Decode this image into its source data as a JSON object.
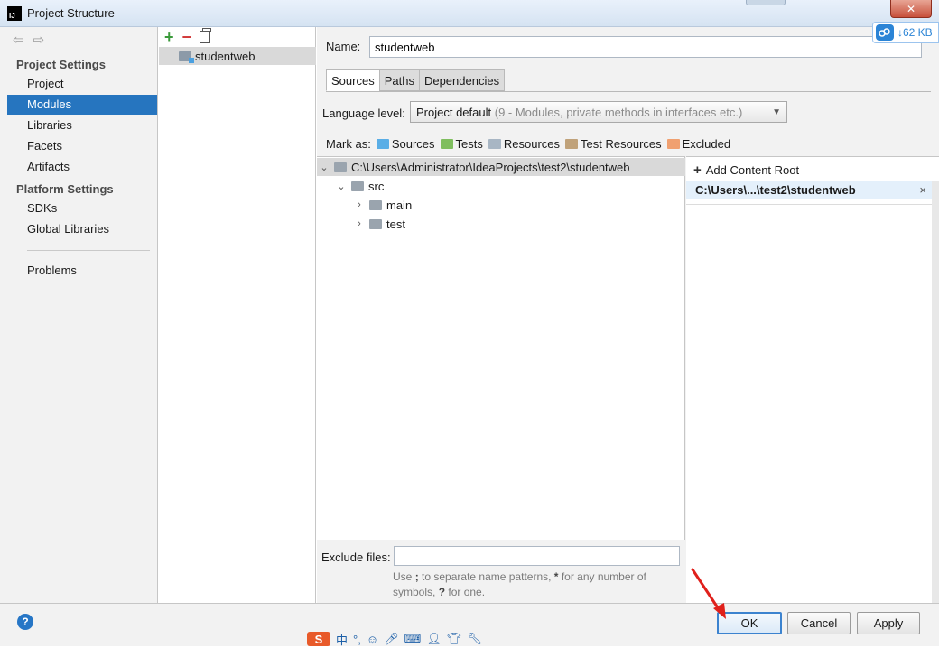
{
  "window": {
    "title": "Project Structure",
    "app_icon": "IJ",
    "close_glyph": "✕",
    "cloud_widget": {
      "icon": "baidu-cloud-icon",
      "text": "↓62 KB"
    }
  },
  "nav": {
    "back_forward_glyphs": "⇦⇨",
    "project_settings_header": "Project Settings",
    "project_settings_items": [
      "Project",
      "Modules",
      "Libraries",
      "Facets",
      "Artifacts"
    ],
    "selected_item": "Modules",
    "platform_settings_header": "Platform Settings",
    "platform_settings_items": [
      "SDKs",
      "Global Libraries"
    ],
    "problems_item": "Problems"
  },
  "modules": {
    "toolbar": {
      "add": "+",
      "remove": "−"
    },
    "items": [
      {
        "name": "studentweb"
      }
    ]
  },
  "module_settings": {
    "name_label": "Name:",
    "name_value": "studentweb",
    "tabs": [
      "Sources",
      "Paths",
      "Dependencies"
    ],
    "active_tab": "Sources",
    "language_level_label": "Language level:",
    "language_level_value": "Project default",
    "language_level_hint": "(9 - Modules, private methods in interfaces etc.)",
    "mark_as_label": "Mark as:",
    "mark_as": [
      {
        "label": "Sources",
        "color": "#5aaee6"
      },
      {
        "label": "Tests",
        "color": "#7fbe5e"
      },
      {
        "label": "Resources",
        "color": "#a8b6c4"
      },
      {
        "label": "Test Resources",
        "color": "#c0a27a"
      },
      {
        "label": "Excluded",
        "color": "#f0a070"
      }
    ],
    "tree": {
      "root": "C:\\Users\\Administrator\\IdeaProjects\\test2\\studentweb",
      "src": "src",
      "children": [
        "main",
        "test"
      ]
    },
    "content_roots": {
      "add_label": "Add Content Root",
      "entries": [
        "C:\\Users\\...\\test2\\studentweb"
      ],
      "remove_glyph": "×"
    },
    "exclude_files_label": "Exclude files:",
    "exclude_files_value": "",
    "exclude_hint_1": "Use",
    "exclude_hint_2": "to separate name patterns,",
    "exclude_hint_3": "for any number of symbols,",
    "exclude_hint_4": "for one.",
    "hint_semicolon": ";",
    "hint_star": "*",
    "hint_question": "?"
  },
  "buttons": {
    "help": "?",
    "ok": "OK",
    "cancel": "Cancel",
    "apply": "Apply",
    "accent_color": "#3c83cf"
  },
  "ime_toolbar": {
    "logo": "S",
    "mode": "中"
  }
}
